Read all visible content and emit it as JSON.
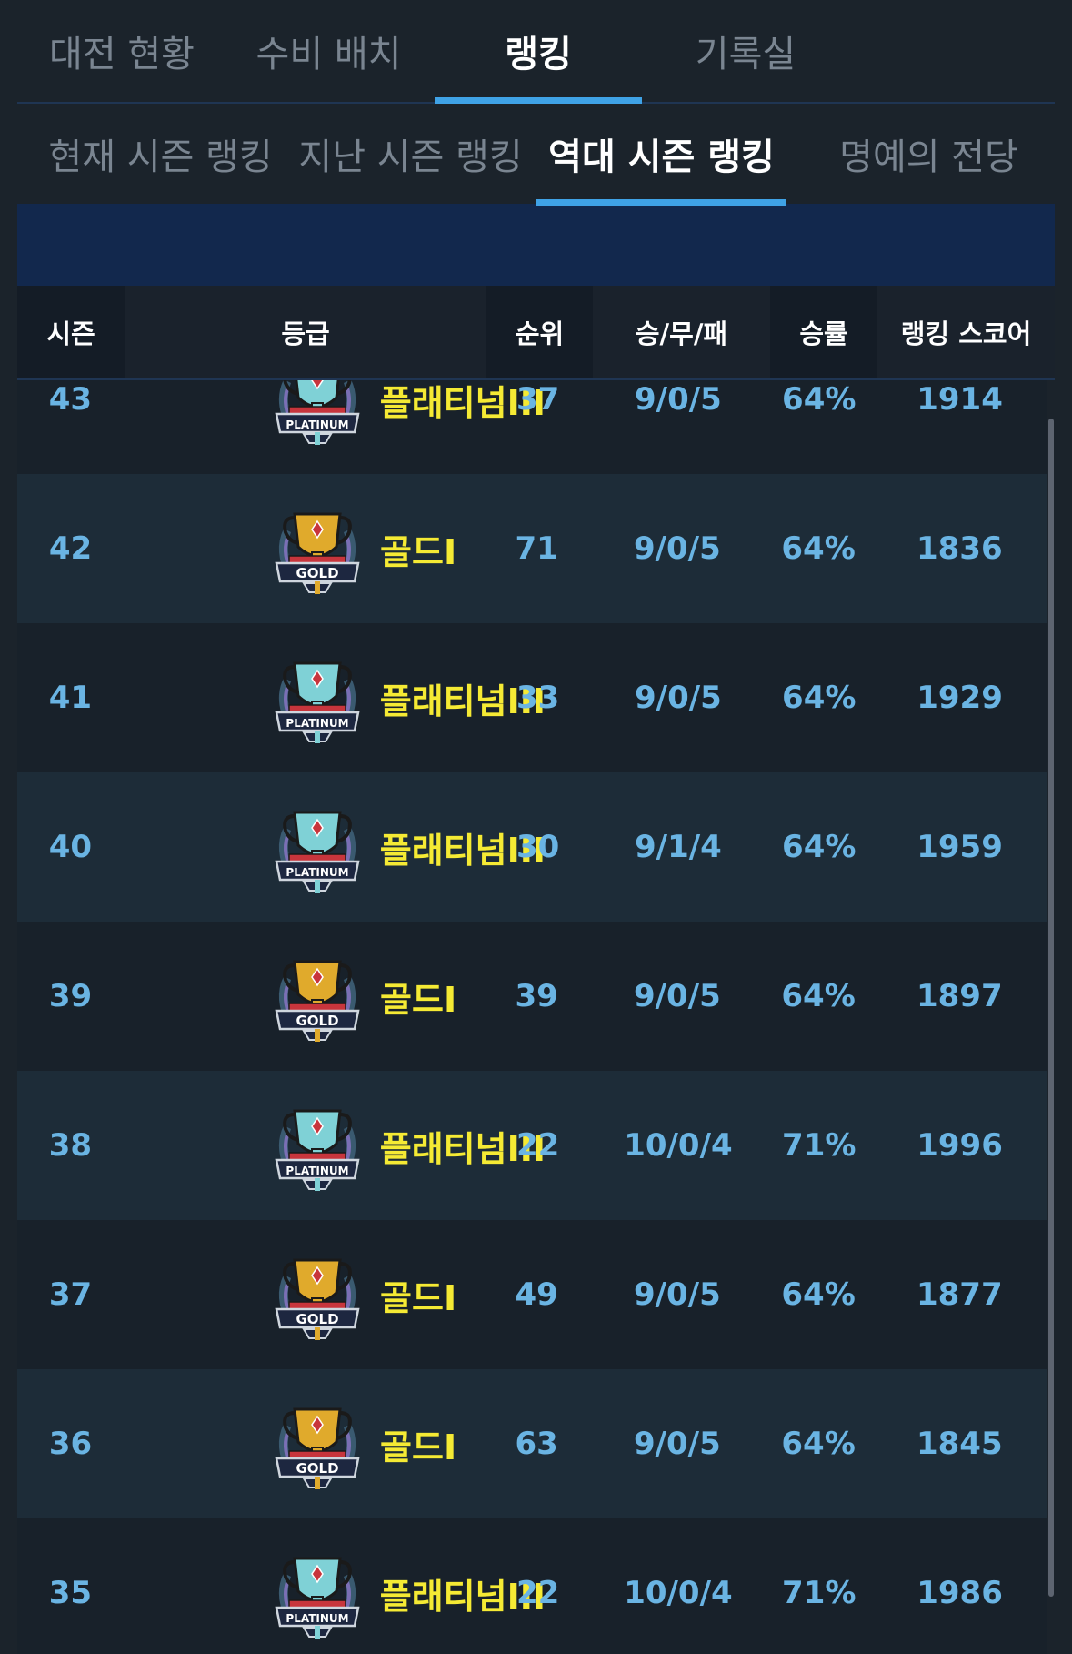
{
  "main_tabs": [
    {
      "label": "대전 현황",
      "active": false
    },
    {
      "label": "수비 배치",
      "active": false
    },
    {
      "label": "랭킹",
      "active": true
    },
    {
      "label": "기록실",
      "active": false
    }
  ],
  "sub_tabs": [
    {
      "label": "현재 시즌 랭킹",
      "active": false
    },
    {
      "label": "지난 시즌 랭킹",
      "active": false
    },
    {
      "label": "역대 시즌 랭킹",
      "active": true
    },
    {
      "label": "명예의 전당",
      "active": false
    }
  ],
  "table": {
    "headers": {
      "season": "시즌",
      "grade": "등급",
      "rank": "순위",
      "wdl": "승/무/패",
      "win_rate": "승률",
      "score": "랭킹 스코어"
    },
    "rows": [
      {
        "season": "43",
        "grade": "플래티넘III",
        "badge": "platinum",
        "rank": "37",
        "wdl": "9/0/5",
        "win_rate": "64%",
        "score": "1914"
      },
      {
        "season": "42",
        "grade": "골드I",
        "badge": "gold",
        "rank": "71",
        "wdl": "9/0/5",
        "win_rate": "64%",
        "score": "1836"
      },
      {
        "season": "41",
        "grade": "플래티넘III",
        "badge": "platinum",
        "rank": "33",
        "wdl": "9/0/5",
        "win_rate": "64%",
        "score": "1929"
      },
      {
        "season": "40",
        "grade": "플래티넘III",
        "badge": "platinum",
        "rank": "30",
        "wdl": "9/1/4",
        "win_rate": "64%",
        "score": "1959"
      },
      {
        "season": "39",
        "grade": "골드I",
        "badge": "gold",
        "rank": "39",
        "wdl": "9/0/5",
        "win_rate": "64%",
        "score": "1897"
      },
      {
        "season": "38",
        "grade": "플래티넘III",
        "badge": "platinum",
        "rank": "22",
        "wdl": "10/0/4",
        "win_rate": "71%",
        "score": "1996"
      },
      {
        "season": "37",
        "grade": "골드I",
        "badge": "gold",
        "rank": "49",
        "wdl": "9/0/5",
        "win_rate": "64%",
        "score": "1877"
      },
      {
        "season": "36",
        "grade": "골드I",
        "badge": "gold",
        "rank": "63",
        "wdl": "9/0/5",
        "win_rate": "64%",
        "score": "1845"
      },
      {
        "season": "35",
        "grade": "플래티넘III",
        "badge": "platinum",
        "rank": "22",
        "wdl": "10/0/4",
        "win_rate": "71%",
        "score": "1986"
      }
    ]
  },
  "badges": {
    "platinum": {
      "text": "PLATINUM",
      "cup": "#7fd1d6",
      "ribbon": "#1d2740",
      "accent": "#c8353c"
    },
    "gold": {
      "text": "GOLD",
      "cup": "#e0aa2c",
      "ribbon": "#1d2740",
      "accent": "#c8353c"
    }
  },
  "colors": {
    "accent": "#3fa2e6",
    "grade_text": "#f5ea34",
    "value_text": "#6ab4e3"
  }
}
